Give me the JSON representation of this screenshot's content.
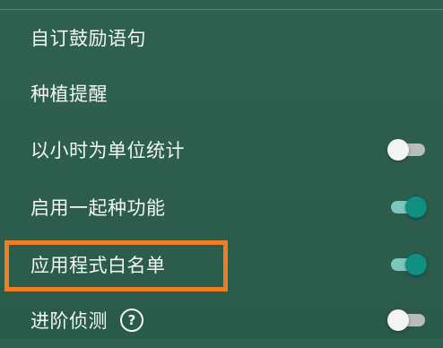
{
  "settings": {
    "items": [
      {
        "label": "自订鼓励语句"
      },
      {
        "label": "种植提醒"
      },
      {
        "label": "以小时为单位统计",
        "toggle": false
      },
      {
        "label": "启用一起种功能",
        "toggle": true
      },
      {
        "label": "应用程式白名单",
        "toggle": true,
        "highlighted": true
      },
      {
        "label": "进阶侦测",
        "help": "?",
        "toggle": false
      }
    ]
  },
  "colors": {
    "background": "#2c5d4d",
    "toggle_on": "#0f8f80",
    "toggle_on_track": "#7cc7bd",
    "toggle_off_track": "#b8bcbb",
    "highlight_border": "#f07c24"
  }
}
